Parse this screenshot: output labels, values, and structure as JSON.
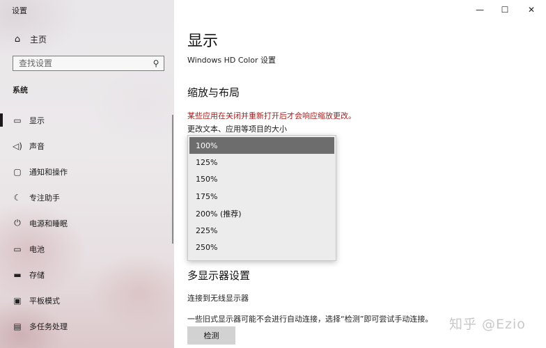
{
  "window": {
    "title": "设置",
    "minimize": "—",
    "maximize": "☐",
    "close": "✕"
  },
  "sidebar": {
    "home": {
      "icon": "home-icon",
      "label": "主页"
    },
    "search": {
      "placeholder": "查找设置",
      "icon": "search-icon"
    },
    "section": "系统",
    "items": [
      {
        "label": "显示",
        "icon": "monitor-icon",
        "selected": true
      },
      {
        "label": "声音",
        "icon": "speaker-icon"
      },
      {
        "label": "通知和操作",
        "icon": "notification-icon"
      },
      {
        "label": "专注助手",
        "icon": "moon-icon"
      },
      {
        "label": "电源和睡眠",
        "icon": "power-icon"
      },
      {
        "label": "电池",
        "icon": "battery-icon"
      },
      {
        "label": "存储",
        "icon": "storage-icon"
      },
      {
        "label": "平板模式",
        "icon": "tablet-icon"
      },
      {
        "label": "多任务处理",
        "icon": "multitask-icon"
      }
    ]
  },
  "main": {
    "title": "显示",
    "hd_color_link": "Windows HD Color 设置",
    "scale_section": {
      "heading": "缩放与布局",
      "warning": "某些应用在关闭并重新打开后才会响应缩放更改。",
      "scale_label": "更改文本、应用等项目的大小",
      "options": [
        "100%",
        "125%",
        "150%",
        "175%",
        "200% (推荐)",
        "225%",
        "250%"
      ],
      "selected": "100%"
    },
    "multi_display": {
      "heading": "多显示器设置",
      "wireless_link": "连接到无线显示器",
      "detect_info": "一些旧式显示器可能不会进行自动连接，选择“检测”即可尝试手动连接。",
      "detect_button": "检测"
    }
  },
  "watermark": "知乎 @Ezio",
  "colors": {
    "warning": "#a12020",
    "dropdown_selected": "#6d6d6d",
    "button_bg": "#d2d2d2"
  }
}
